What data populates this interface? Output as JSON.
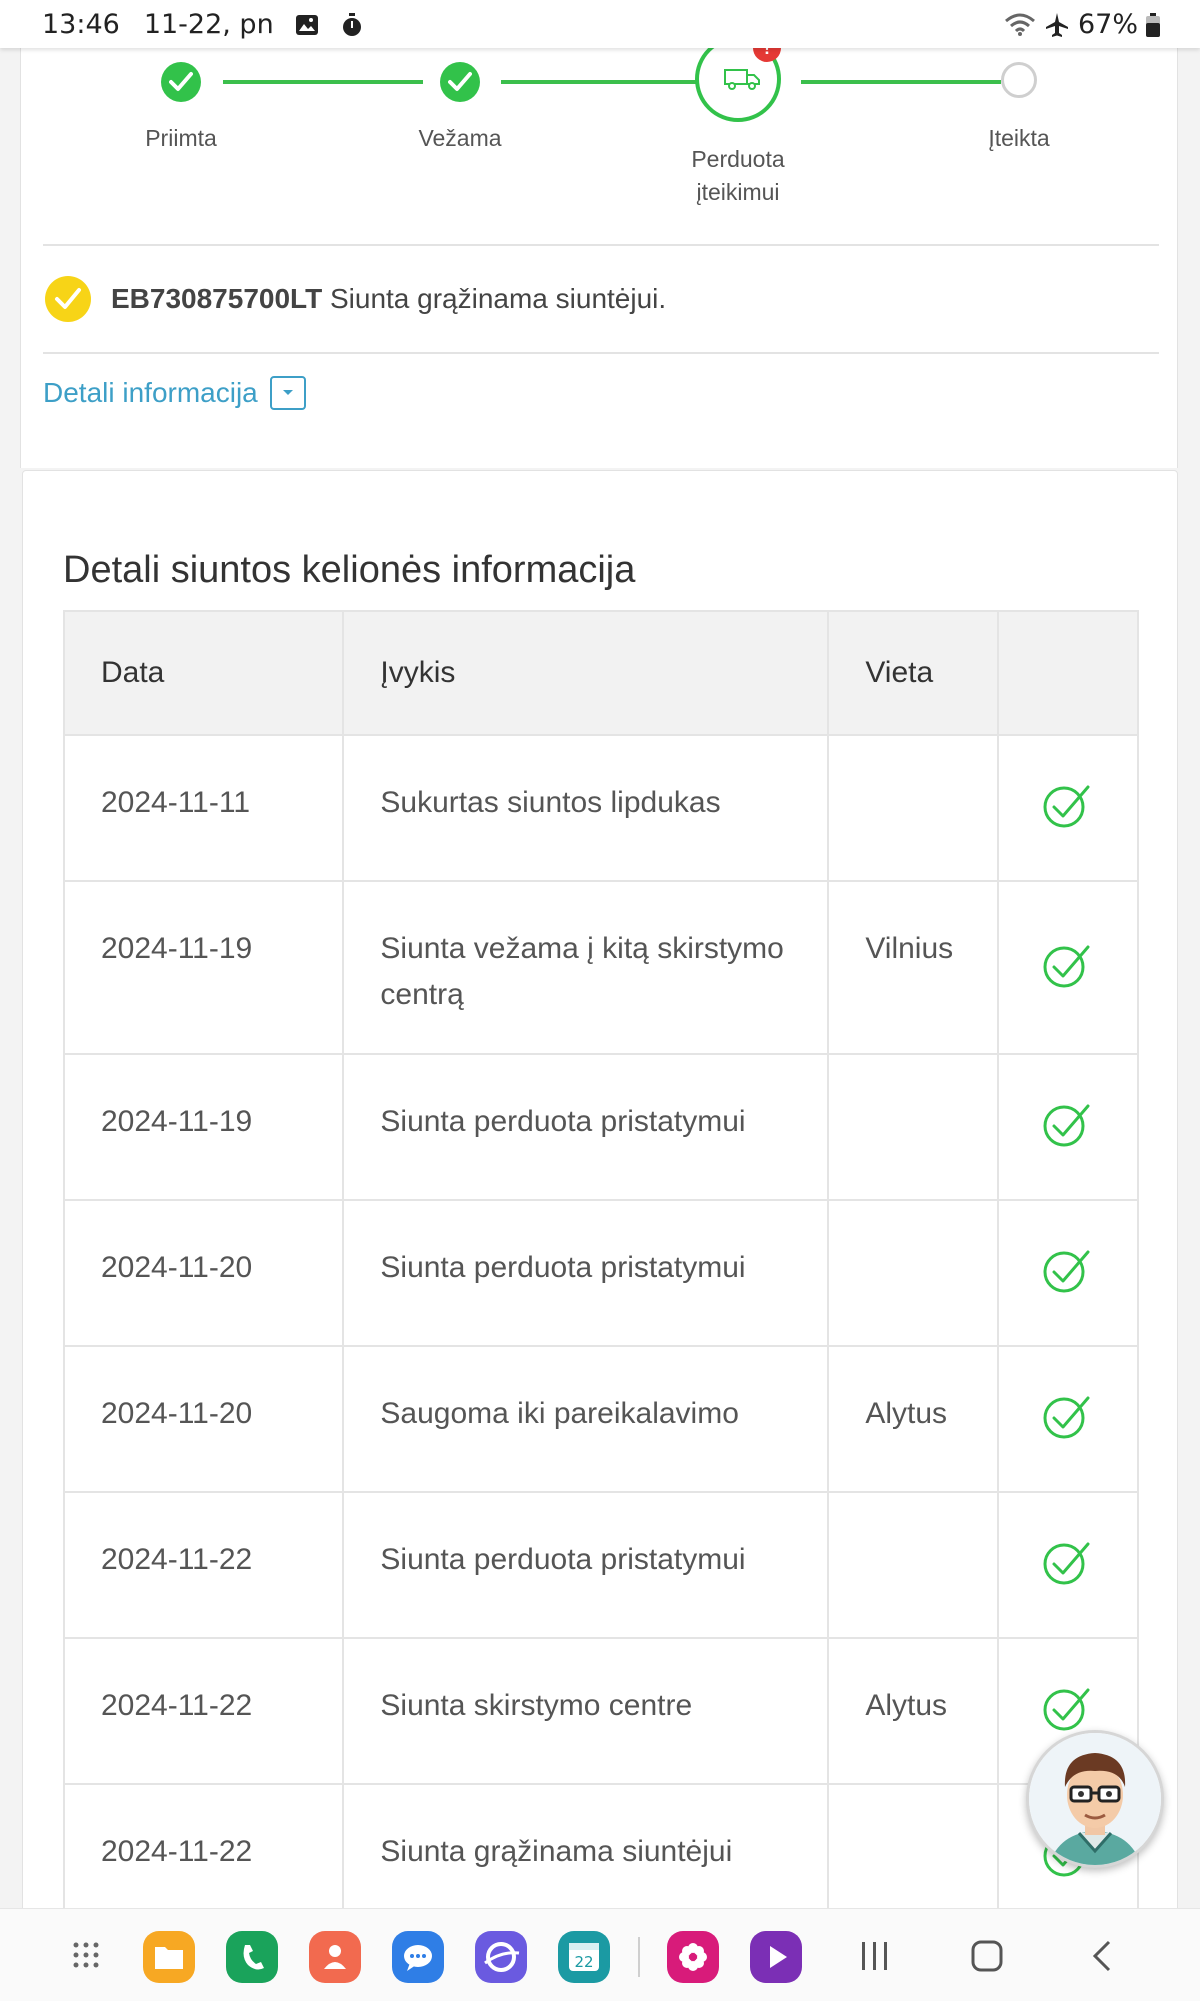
{
  "status_bar": {
    "time": "13:46",
    "date": "11-22, pn",
    "battery": "67%",
    "icons": [
      "image-icon",
      "stopwatch-icon",
      "wifi-icon",
      "airplane-icon",
      "battery-icon"
    ]
  },
  "tracking": {
    "steps": [
      {
        "label": "Priimta",
        "state": "done"
      },
      {
        "label": "Vežama",
        "state": "done"
      },
      {
        "label": "Perduota įteikimui",
        "state": "active",
        "alert": "!"
      },
      {
        "label": "Įteikta",
        "state": "pending"
      }
    ],
    "shipment_id": "EB730875700LT",
    "status_message": "Siunta grąžinama siuntėjui.",
    "detail_link": "Detali informacija"
  },
  "journey": {
    "title": "Detali siuntos kelionės informacija",
    "columns": [
      "Data",
      "Įvykis",
      "Vieta",
      ""
    ],
    "rows": [
      {
        "date": "2024-11-11",
        "event": "Sukurtas siuntos lipdukas",
        "place": ""
      },
      {
        "date": "2024-11-19",
        "event": "Siunta vežama į kitą skirstymo centrą",
        "place": "Vilnius"
      },
      {
        "date": "2024-11-19",
        "event": "Siunta perduota pristatymui",
        "place": ""
      },
      {
        "date": "2024-11-20",
        "event": "Siunta perduota pristatymui",
        "place": ""
      },
      {
        "date": "2024-11-20",
        "event": "Saugoma iki pareikalavimo",
        "place": "Alytus"
      },
      {
        "date": "2024-11-22",
        "event": "Siunta perduota pristatymui",
        "place": ""
      },
      {
        "date": "2024-11-22",
        "event": "Siunta skirstymo centre",
        "place": "Alytus"
      },
      {
        "date": "2024-11-22",
        "event": "Siunta grąžinama siuntėjui",
        "place": ""
      }
    ]
  },
  "nav_bar": {
    "calendar_day": "22",
    "apps": [
      "apps-grid-icon",
      "files-icon",
      "phone-icon",
      "contacts-icon",
      "messages-icon",
      "internet-icon",
      "calendar-icon",
      "gallery-icon",
      "video-player-icon"
    ],
    "buttons": [
      "recents-button",
      "home-button",
      "back-button"
    ]
  },
  "colors": {
    "success": "#32c24a",
    "accent": "#3d9fc7",
    "warning": "#f7d417",
    "alert": "#e53935"
  }
}
